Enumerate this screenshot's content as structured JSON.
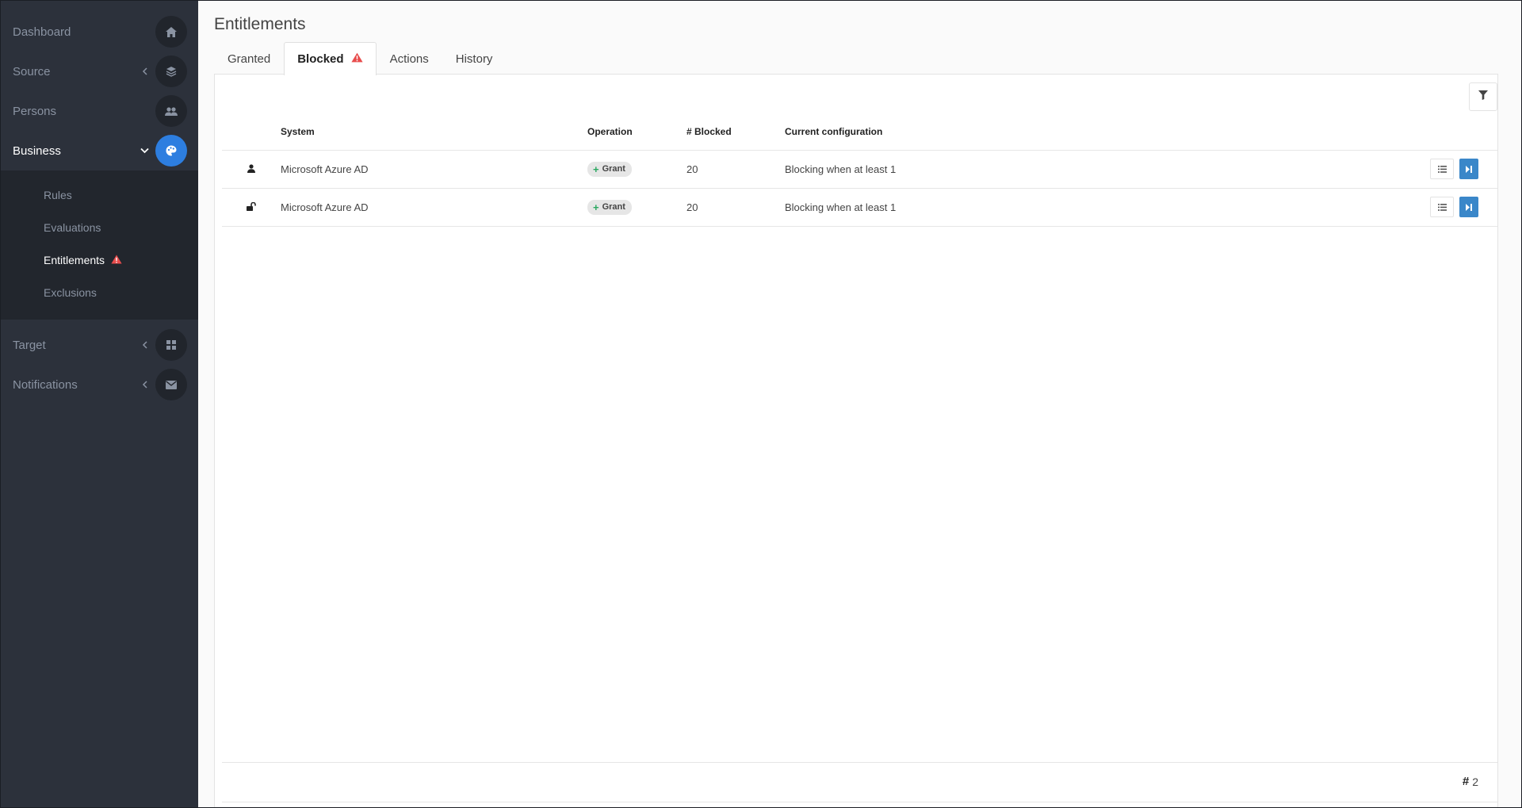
{
  "sidebar": {
    "items": [
      {
        "label": "Dashboard",
        "icon": "home-icon"
      },
      {
        "label": "Source",
        "icon": "layers-icon"
      },
      {
        "label": "Persons",
        "icon": "users-icon"
      },
      {
        "label": "Business",
        "icon": "palette-icon"
      },
      {
        "label": "Target",
        "icon": "grid-icon"
      },
      {
        "label": "Notifications",
        "icon": "envelope-icon"
      }
    ],
    "business_sub": [
      {
        "label": "Rules"
      },
      {
        "label": "Evaluations"
      },
      {
        "label": "Entitlements"
      },
      {
        "label": "Exclusions"
      }
    ]
  },
  "page": {
    "title": "Entitlements",
    "tabs": [
      {
        "label": "Granted"
      },
      {
        "label": "Blocked"
      },
      {
        "label": "Actions"
      },
      {
        "label": "History"
      }
    ]
  },
  "table": {
    "headers": [
      "System",
      "Operation",
      "# Blocked",
      "Current configuration"
    ],
    "rows": [
      {
        "icon": "user-icon",
        "system": "Microsoft Azure AD",
        "operation": "Grant",
        "blocked": "20",
        "config": "Blocking when at least 1"
      },
      {
        "icon": "unlock-icon",
        "system": "Microsoft Azure AD",
        "operation": "Grant",
        "blocked": "20",
        "config": "Blocking when at least 1"
      }
    ]
  },
  "footer": {
    "count": "2"
  },
  "colors": {
    "sidebar_bg": "#2c313b",
    "submenu_bg": "#22262d",
    "accent": "#2d7ee0",
    "warning": "#e84c4c",
    "grant_plus": "#2aa860",
    "action_primary": "#3a87c9"
  }
}
